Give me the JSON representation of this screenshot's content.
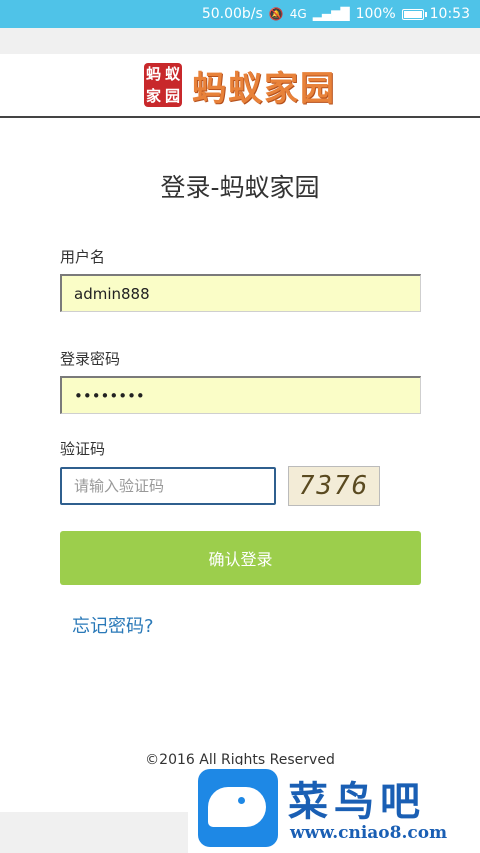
{
  "status_bar": {
    "speed": "50.00b/s",
    "mute_icon": "mute-icon",
    "signal": "4G",
    "battery_percent": "100%",
    "battery_level": 1.0,
    "time": "10:53"
  },
  "header": {
    "seal_chars": [
      "蚂",
      "蚁",
      "家",
      "园"
    ],
    "brand": "蚂蚁家园"
  },
  "form": {
    "title": "登录-蚂蚁家园",
    "username_label": "用户名",
    "username_value": "admin888",
    "password_label": "登录密码",
    "password_value": "••••••••",
    "captcha_label": "验证码",
    "captcha_placeholder": "请输入验证码",
    "captcha_code": "7376",
    "submit_label": "确认登录",
    "forgot_link": "忘记密码?"
  },
  "footer": {
    "copyright": "©2016 All Rights Reserved"
  },
  "watermark": {
    "name": "菜鸟吧",
    "url": "www.cniao8.com"
  },
  "colors": {
    "status_bar": "#4fc3e8",
    "field_bg": "#fafdc7",
    "button": "#9cce4c",
    "link": "#2a79b8",
    "brand": "#e8823a",
    "seal": "#c8282b"
  }
}
